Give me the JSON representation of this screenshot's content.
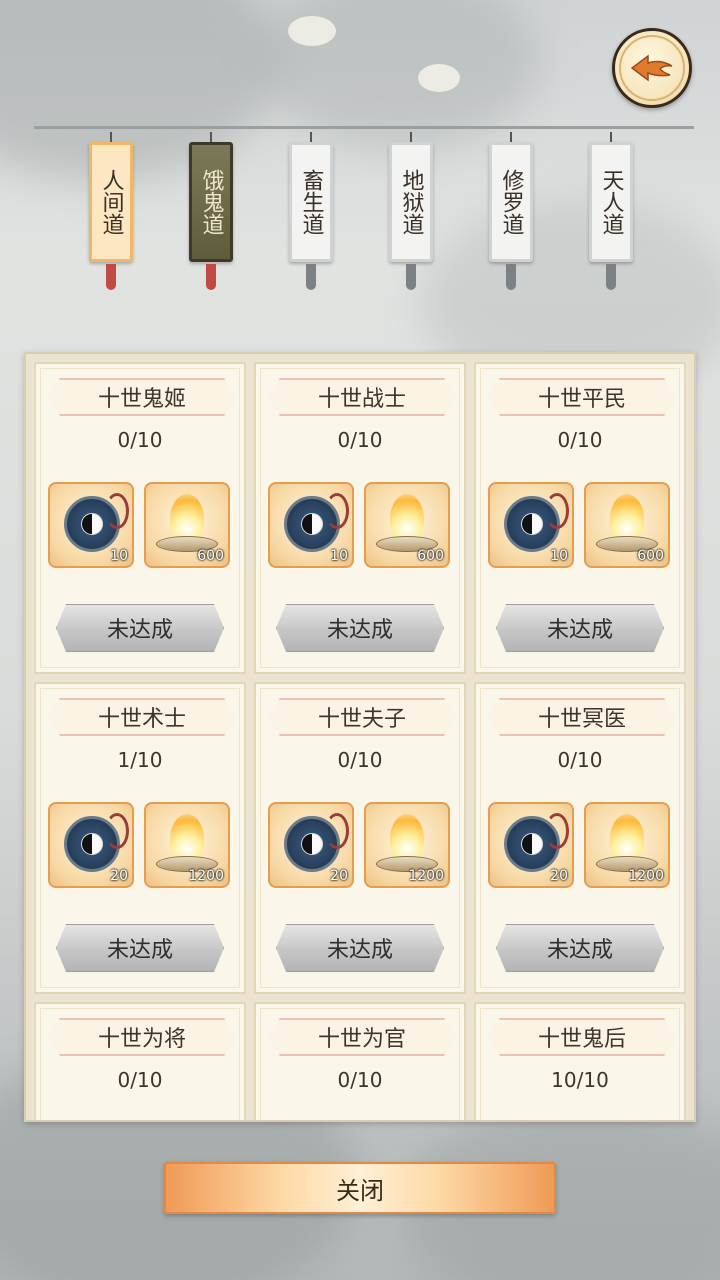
{
  "tabs": [
    {
      "label": "人间道",
      "state": "active"
    },
    {
      "label": "饿鬼道",
      "state": "dark"
    },
    {
      "label": "畜生道",
      "state": "normal"
    },
    {
      "label": "地狱道",
      "state": "normal"
    },
    {
      "label": "修罗道",
      "state": "normal"
    },
    {
      "label": "天人道",
      "state": "normal"
    }
  ],
  "cards": [
    {
      "title": "十世鬼姬",
      "progress": "0/10",
      "reward1_qty": "10",
      "reward2_qty": "600",
      "status": "未达成"
    },
    {
      "title": "十世战士",
      "progress": "0/10",
      "reward1_qty": "10",
      "reward2_qty": "600",
      "status": "未达成"
    },
    {
      "title": "十世平民",
      "progress": "0/10",
      "reward1_qty": "10",
      "reward2_qty": "600",
      "status": "未达成"
    },
    {
      "title": "十世术士",
      "progress": "1/10",
      "reward1_qty": "20",
      "reward2_qty": "1200",
      "status": "未达成"
    },
    {
      "title": "十世夫子",
      "progress": "0/10",
      "reward1_qty": "20",
      "reward2_qty": "1200",
      "status": "未达成"
    },
    {
      "title": "十世冥医",
      "progress": "0/10",
      "reward1_qty": "20",
      "reward2_qty": "1200",
      "status": "未达成"
    },
    {
      "title": "十世为将",
      "progress": "0/10"
    },
    {
      "title": "十世为官",
      "progress": "0/10"
    },
    {
      "title": "十世鬼后",
      "progress": "10/10"
    }
  ],
  "icons": {
    "back": "back-arrow-icon",
    "reward1": "yin-yang-compass-icon",
    "reward2": "incense-flame-icon"
  },
  "colors": {
    "active_tab": "#fde7c2",
    "reward_border": "#e69d4f",
    "close_button": "#f09a56"
  },
  "close_label": "关闭"
}
